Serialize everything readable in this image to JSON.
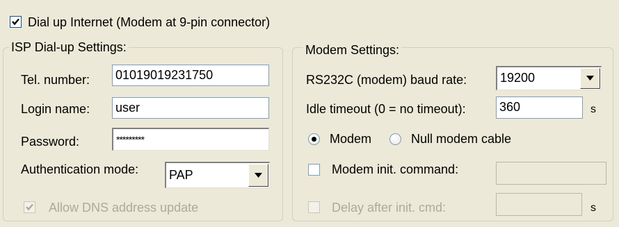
{
  "dialup": {
    "label": "Dial up Internet (Modem at 9-pin connector)",
    "checked": true
  },
  "isp": {
    "legend": "ISP Dial-up Settings:",
    "tel_label": "Tel. number:",
    "tel_value": "01019019231750",
    "login_label": "Login name:",
    "login_value": "user",
    "password_label": "Password:",
    "password_value": "*********",
    "auth_label": "Authentication mode:",
    "auth_value": "PAP",
    "dns_label": "Allow DNS address update",
    "dns_checked": true,
    "dns_enabled": false
  },
  "modem": {
    "legend": "Modem Settings:",
    "baud_label": "RS232C (modem) baud rate:",
    "baud_value": "19200",
    "idle_label": "Idle timeout (0 = no timeout):",
    "idle_value": "360",
    "idle_unit": "s",
    "radio_modem_label": "Modem",
    "radio_null_label": "Null modem cable",
    "selected_connection": "Modem",
    "init_label": "Modem init. command:",
    "init_value": "",
    "init_checked": false,
    "delay_label": "Delay after init. cmd:",
    "delay_value": "",
    "delay_unit": "s",
    "delay_enabled": false
  }
}
